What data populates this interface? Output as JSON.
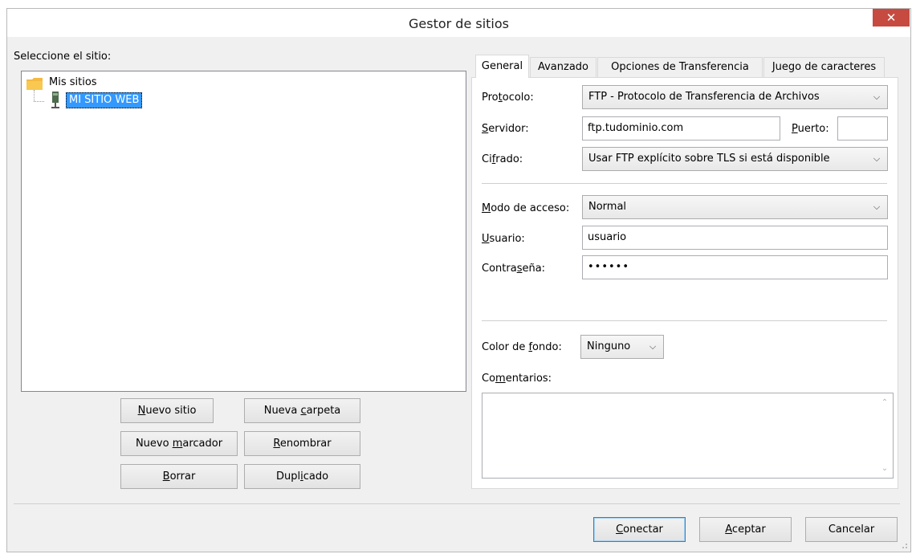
{
  "window": {
    "title": "Gestor de sitios",
    "close_glyph": "✕"
  },
  "site_tree": {
    "label": "Seleccione el sitio:",
    "root": {
      "label": "Mis sitios",
      "icon": "folder-icon"
    },
    "child": {
      "label": "MI SITIO WEB",
      "icon": "server-icon"
    }
  },
  "tree_buttons": {
    "new_site": {
      "pre": "",
      "key": "N",
      "post": "uevo sitio"
    },
    "new_folder": {
      "pre": "Nueva ",
      "key": "c",
      "post": "arpeta"
    },
    "new_bookmark": {
      "pre": "Nuevo ",
      "key": "m",
      "post": "arcador"
    },
    "rename": {
      "pre": "",
      "key": "R",
      "post": "enombrar"
    },
    "delete": {
      "pre": "",
      "key": "B",
      "post": "orrar"
    },
    "duplicate": {
      "pre": "Dupl",
      "key": "i",
      "post": "cado"
    }
  },
  "tabs": [
    "General",
    "Avanzado",
    "Opciones de Transferencia",
    "Juego de caracteres"
  ],
  "general": {
    "protocol": {
      "pre": "Pro",
      "key": "t",
      "post": "ocolo:",
      "value": "FTP - Protocolo de Transferencia de Archivos"
    },
    "server": {
      "pre": "",
      "key": "S",
      "post": "ervidor:",
      "value": "ftp.tudominio.com"
    },
    "port": {
      "pre": "",
      "key": "P",
      "post": "uerto:",
      "value": ""
    },
    "encryption": {
      "pre": "Ci",
      "key": "f",
      "post": "rado:",
      "value": "Usar FTP explícito sobre TLS si está disponible"
    },
    "logon_type": {
      "pre": "",
      "key": "M",
      "post": "odo de acceso:",
      "value": "Normal"
    },
    "user": {
      "pre": "",
      "key": "U",
      "post": "suario:",
      "value": "usuario"
    },
    "password": {
      "pre": "Contra",
      "key": "s",
      "post": "eña:",
      "value": "••••••"
    },
    "background_color": {
      "pre": "Color de ",
      "key": "f",
      "post": "ondo:",
      "value": "Ninguno"
    },
    "comments": {
      "pre": "Co",
      "key": "m",
      "post": "entarios:",
      "value": ""
    }
  },
  "footer": {
    "connect": {
      "pre": "",
      "key": "C",
      "post": "onectar"
    },
    "ok": {
      "pre": "",
      "key": "A",
      "post": "ceptar"
    },
    "cancel": {
      "label": "Cancelar"
    }
  }
}
